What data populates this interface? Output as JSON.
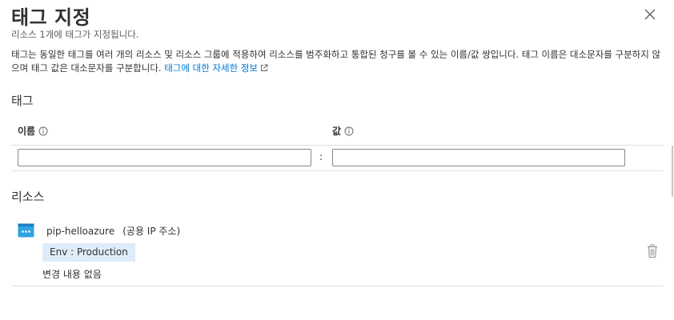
{
  "header": {
    "title": "태그 지정",
    "subtitle": "리소스 1개에 태그가 지정됩니다."
  },
  "description": {
    "text": "태그는 동일한 태그를 여러 개의 리소스 및 리소스 그룹에 적용하여 리소스를 범주화하고 통합된 청구를 볼 수 있는 이름/값 쌍입니다. 태그 이름은 대소문자를 구분하지 않으며 태그 값은 대소문자를 구분합니다.",
    "link_label": "태그에 대한 자세한 정보"
  },
  "tags_section": {
    "title": "태그",
    "name_column": "이름",
    "value_column": "값",
    "separator": ":",
    "name_input_value": "",
    "value_input_value": ""
  },
  "resources_section": {
    "title": "리소스",
    "resource": {
      "name": "pip-helloazure",
      "type": "(공용 IP 주소)",
      "tag": "Env : Production",
      "status": "변경 내용 없음"
    }
  },
  "icons": {
    "close": "close-icon",
    "info": "info-icon",
    "external_link": "external-link-icon",
    "resource": "public-ip-icon",
    "delete": "trash-icon"
  },
  "colors": {
    "link": "#0078d4",
    "tag_chip_bg": "#deecf9",
    "resource_icon": "#2ea4e0"
  }
}
